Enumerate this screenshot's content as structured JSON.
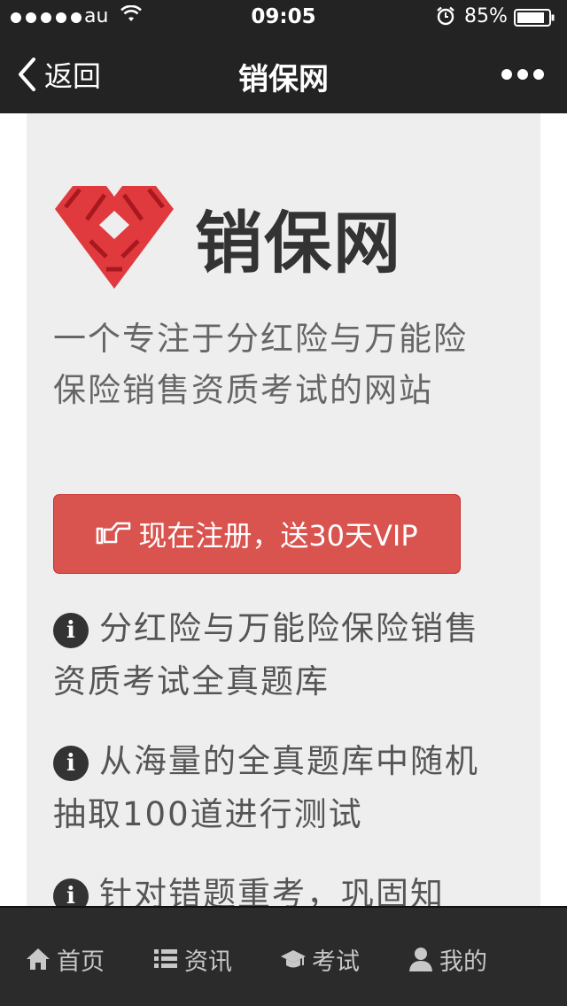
{
  "status_bar": {
    "carrier": "au",
    "time": "09:05",
    "battery": "85%"
  },
  "nav": {
    "back_label": "返回",
    "title": "销保网"
  },
  "brand": {
    "name": "销保网",
    "color": "#e03a3e"
  },
  "tagline": "一个专注于分红险与万能险保险销售资质考试的网站",
  "cta": {
    "label": "现在注册，送30天VIP",
    "color": "#d9534f"
  },
  "features": [
    "分红险与万能险保险销售资质考试全真题库",
    "从海量的全真题库中随机抽取100道进行测试",
    "针对错题重考，巩固知"
  ],
  "tabs": [
    {
      "label": "首页",
      "icon": "home-icon"
    },
    {
      "label": "资讯",
      "icon": "list-icon"
    },
    {
      "label": "考试",
      "icon": "graduation-cap-icon"
    },
    {
      "label": "我的",
      "icon": "user-icon"
    }
  ]
}
